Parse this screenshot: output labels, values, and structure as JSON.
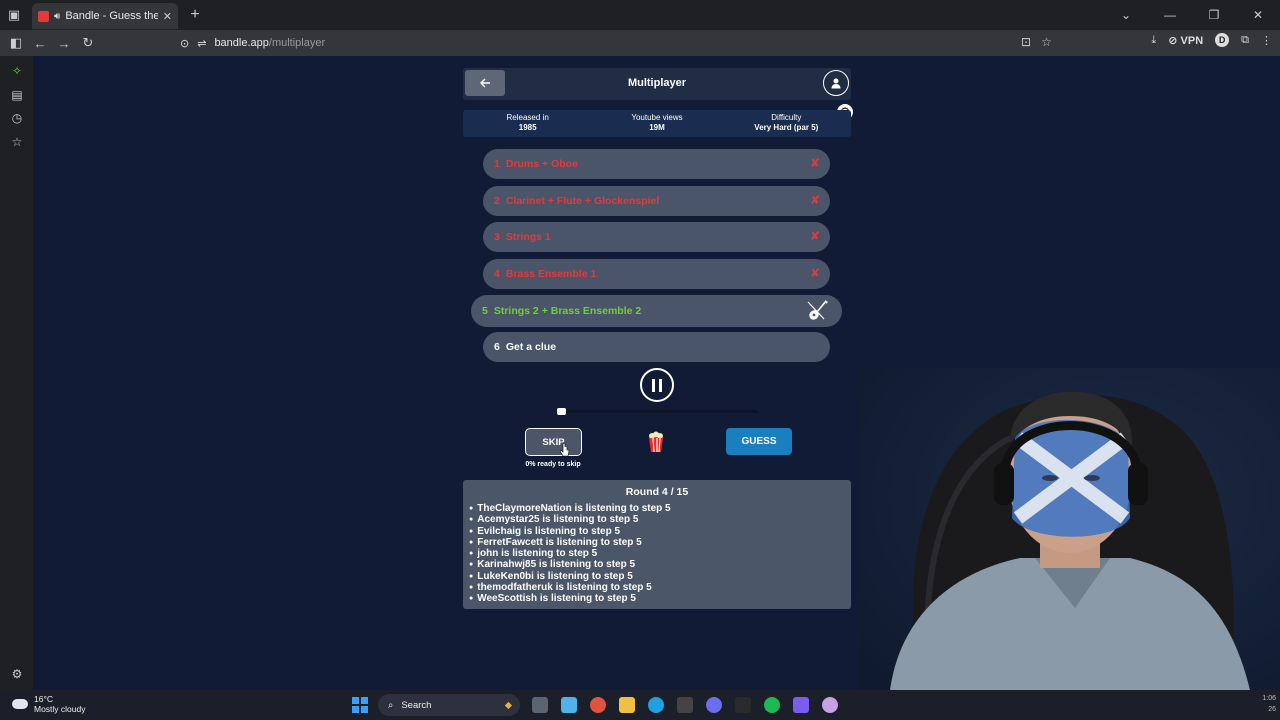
{
  "browser": {
    "tab_title": "Bandle - Guess the song, o",
    "url_host": "bandle.app",
    "url_path": "/multiplayer",
    "vpn_label": "VPN",
    "profile_initial": "D"
  },
  "header": {
    "title": "Multiplayer"
  },
  "info": [
    {
      "label": "Released in",
      "value": "1985"
    },
    {
      "label": "Youtube views",
      "value": "19M"
    },
    {
      "label": "Difficulty",
      "value": "Very Hard (par 5)"
    }
  ],
  "steps": [
    {
      "num": "1",
      "label": "Drums + Oboe"
    },
    {
      "num": "2",
      "label": "Clarinet + Flute + Glockenspiel"
    },
    {
      "num": "3",
      "label": "Strings 1"
    },
    {
      "num": "4",
      "label": "Brass Ensemble 1"
    },
    {
      "num": "5",
      "label": "Strings 2 + Brass Ensemble 2"
    },
    {
      "num": "6",
      "label": "Get a clue"
    }
  ],
  "player": {
    "progress": 0.0
  },
  "controls": {
    "skip_label": "SKIP",
    "skip_note": "0% ready to skip",
    "guess_label": "GUESS"
  },
  "round": {
    "title": "Round 4 / 15",
    "players": [
      "TheClaymoreNation is listening to step 5",
      "Acemystar25 is listening to step 5",
      "Evilchaig is listening to step 5",
      "FerretFawcett is listening to step 5",
      "john is listening to step 5",
      "Karinahwj85 is listening to step 5",
      "LukeKen0bi is listening to step 5",
      "themodfatheruk is listening to step 5",
      "WeeScottish is listening to step 5"
    ]
  },
  "taskbar": {
    "temperature": "16°C",
    "weather": "Mostly cloudy",
    "search_label": "Search",
    "time": "1:06",
    "date": "26"
  },
  "colors": {
    "fail": "#e23a3a",
    "active": "#6ecf3a",
    "guess": "#1a7fbf"
  }
}
